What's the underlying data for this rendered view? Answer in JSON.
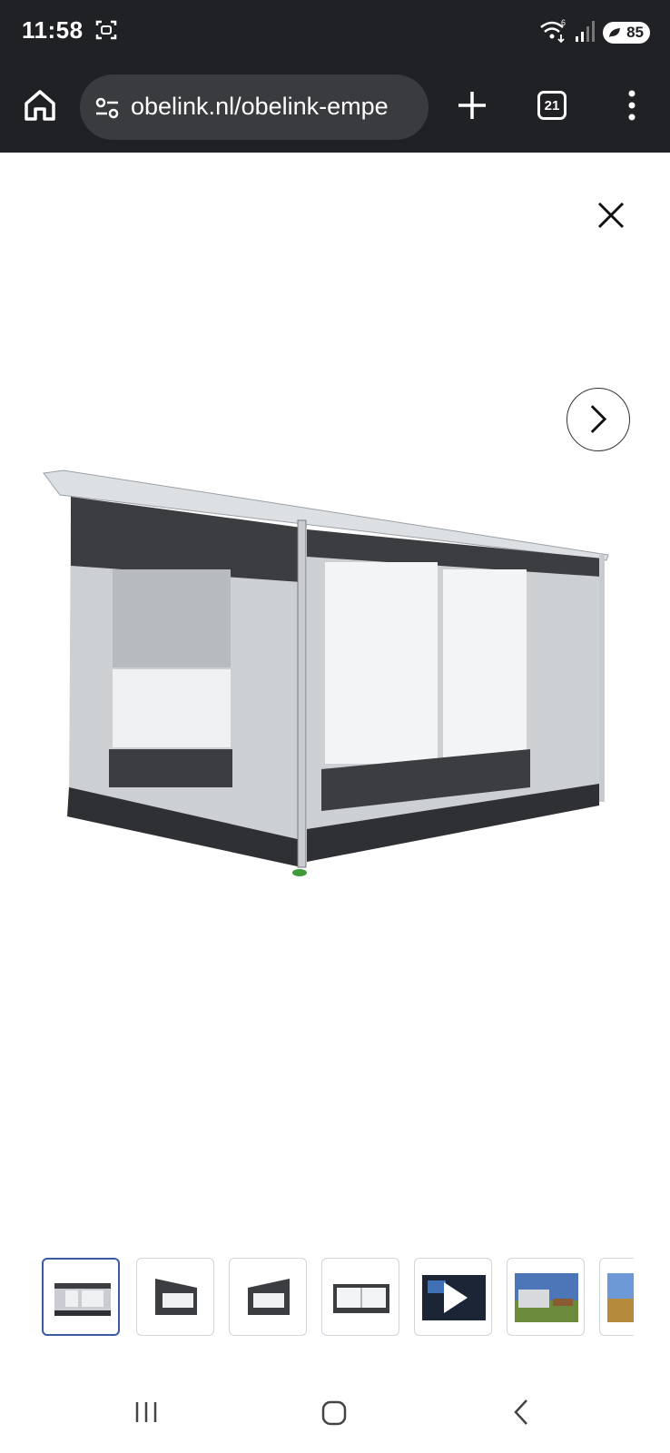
{
  "status_bar": {
    "time": "11:58",
    "battery": "85",
    "wifi_label": "6",
    "icons": [
      "screenshot-icon",
      "wifi-icon",
      "signal-icon",
      "battery-icon"
    ]
  },
  "toolbar": {
    "url": "obelink.nl/obelink-empe",
    "tab_count": "21",
    "icons": [
      "home-icon",
      "site-settings-icon",
      "plus-icon",
      "tabs-icon",
      "more-vert-icon"
    ]
  },
  "gallery": {
    "selected_index": 0,
    "thumbnail_kinds": [
      "awning-front",
      "awning-side",
      "awning-side",
      "awning-panel",
      "video",
      "photo-outdoor",
      "photo-partial"
    ],
    "controls": [
      "close-icon",
      "chevron-right-icon"
    ]
  },
  "navbar": {
    "icons": [
      "recents-icon",
      "home-circle-icon",
      "back-icon"
    ]
  },
  "colors": {
    "system_bar": "#202124",
    "url_bar": "#3a3b3e",
    "selected_thumb_border": "#3b5aa6",
    "tent_dark": "#3b3d40",
    "tent_light": "#cdd0d3"
  }
}
